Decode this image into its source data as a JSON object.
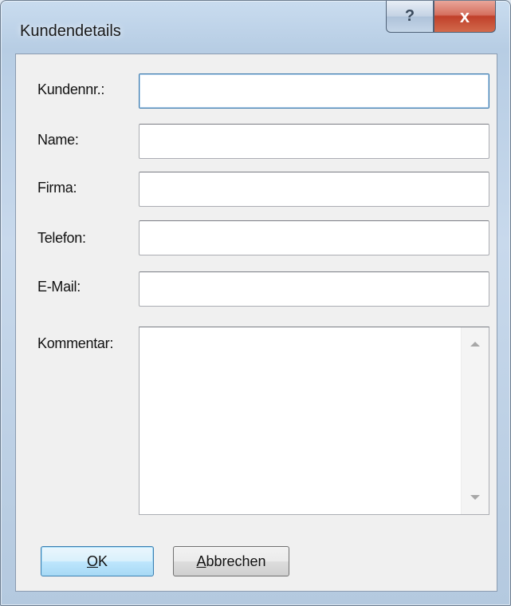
{
  "window": {
    "title": "Kundendetails",
    "help_glyph": "?",
    "close_glyph": "x"
  },
  "form": {
    "fields": [
      {
        "label": "Kundennr.:",
        "value": ""
      },
      {
        "label": "Name:",
        "value": ""
      },
      {
        "label": "Firma:",
        "value": ""
      },
      {
        "label": "Telefon:",
        "value": ""
      },
      {
        "label": "E-Mail:",
        "value": ""
      }
    ],
    "comment": {
      "label": "Kommentar:",
      "value": ""
    }
  },
  "buttons": {
    "ok": {
      "mnemonic": "O",
      "rest": "K"
    },
    "cancel": {
      "mnemonic": "A",
      "rest": "bbrechen"
    }
  },
  "colors": {
    "focus_border": "#3d7bad",
    "close_red": "#c0402a",
    "client_bg": "#f0f0f0"
  }
}
